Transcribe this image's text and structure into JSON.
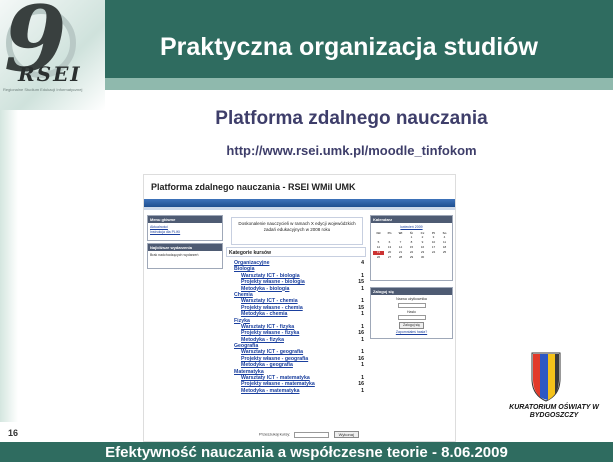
{
  "slide": {
    "title": "Praktyczna organizacja studiów",
    "subtitle": "Platforma zdalnego nauczania",
    "url": "http://www.rsei.umk.pl/moodle_tinfokom",
    "page_number": "16",
    "footer": "Efektywność nauczania a współczesne teorie - 8.06.2009",
    "logo_text": "RSEI",
    "logo_caption": "Regionalne Studium Edukacji Informatycznej",
    "partner_logo_text": "KURATORIUM OŚWIATY W BYDGOSZCZY",
    "colors": {
      "accent": "#2f6c60",
      "title_text": "#3e3e6a",
      "link": "#1a3f9e"
    }
  },
  "screenshot": {
    "page_title": "Platforma zdalnego nauczania - RSEI WMiI UMK",
    "left_blocks": [
      {
        "title": "Menu główne",
        "items": [
          "Aktualności",
          "Instrukcja dla PLIKI"
        ]
      },
      {
        "title": "Najbliższe wydarzenia",
        "items": [
          "Brak nadchodzących wydarzeń"
        ]
      }
    ],
    "intro_text": "Doskonalenie nauczycieli w ramach X edycji wojewódzkich zadań edukacyjnych w 2008 roku",
    "categories_heading": "Kategorie kursów",
    "courses": [
      {
        "name": "Organizacyjne",
        "count": "4",
        "type": "cat"
      },
      {
        "name": "Biologia",
        "count": "",
        "type": "cat"
      },
      {
        "name": "Warsztaty ICT - biologia",
        "count": "1",
        "type": "sub"
      },
      {
        "name": "Projekty własne - biologia",
        "count": "15",
        "type": "sub"
      },
      {
        "name": "Metodyka - biologia",
        "count": "1",
        "type": "sub"
      },
      {
        "name": "Chemia",
        "count": "",
        "type": "cat"
      },
      {
        "name": "Warsztaty ICT - chemia",
        "count": "1",
        "type": "sub"
      },
      {
        "name": "Projekty własne - chemia",
        "count": "15",
        "type": "sub"
      },
      {
        "name": "Metodyka - chemia",
        "count": "1",
        "type": "sub"
      },
      {
        "name": "Fizyka",
        "count": "",
        "type": "cat"
      },
      {
        "name": "Warsztaty ICT - fizyka",
        "count": "1",
        "type": "sub"
      },
      {
        "name": "Projekty własne - fizyka",
        "count": "16",
        "type": "sub"
      },
      {
        "name": "Metodyka - fizyka",
        "count": "1",
        "type": "sub"
      },
      {
        "name": "Geografia",
        "count": "",
        "type": "cat"
      },
      {
        "name": "Warsztaty ICT - geografia",
        "count": "1",
        "type": "sub"
      },
      {
        "name": "Projekty własne - geografia",
        "count": "16",
        "type": "sub"
      },
      {
        "name": "Metodyka - geografia",
        "count": "1",
        "type": "sub"
      },
      {
        "name": "Matematyka",
        "count": "",
        "type": "cat"
      },
      {
        "name": "Warsztaty ICT - matematyka",
        "count": "1",
        "type": "sub"
      },
      {
        "name": "Projekty własne - matematyka",
        "count": "16",
        "type": "sub"
      },
      {
        "name": "Metodyka - matematyka",
        "count": "1",
        "type": "sub"
      }
    ],
    "search_label": "Przeszukaj kursy:",
    "search_button": "Wykonaj",
    "calendar": {
      "title": "Kalendarz",
      "month": "kwiecień 2009",
      "days_header": [
        "Nd",
        "Pn",
        "Wt",
        "Śr",
        "Cz",
        "Pt",
        "So"
      ],
      "days": [
        "",
        "",
        "",
        "1",
        "2",
        "3",
        "4",
        "5",
        "6",
        "7",
        "8",
        "9",
        "10",
        "11",
        "12",
        "13",
        "14",
        "15",
        "16",
        "17",
        "18",
        "19",
        "20",
        "21",
        "22",
        "23",
        "24",
        "25",
        "26",
        "27",
        "28",
        "29",
        "30",
        "",
        ""
      ],
      "today": "19"
    },
    "login": {
      "title": "Zaloguj się",
      "user_label": "Nazwa użytkownika",
      "pass_label": "Hasło",
      "button": "Zaloguj się",
      "forgot": "Zapomniałeś hasła?"
    }
  }
}
